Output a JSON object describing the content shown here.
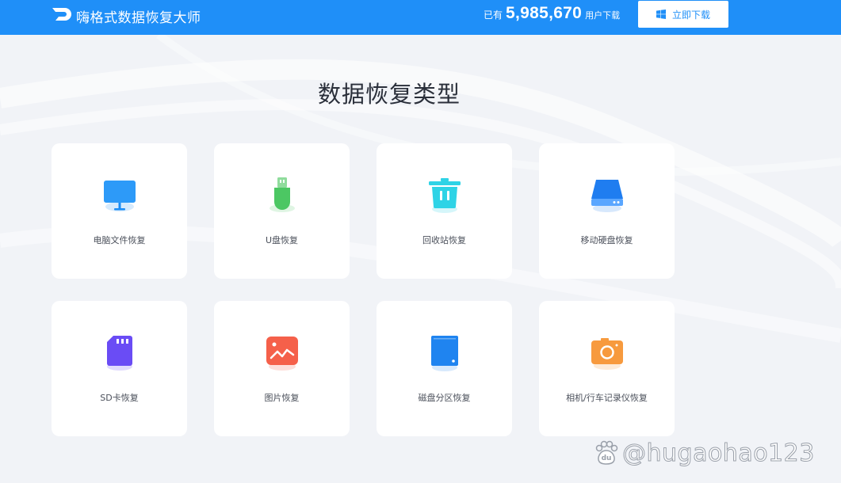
{
  "header": {
    "app_title": "嗨格式数据恢复大师",
    "stats_prefix": "已有",
    "stats_number": "5,985,670",
    "stats_suffix": "用户下载",
    "download_label": "立即下载",
    "brand_color": "#1f8ff8"
  },
  "main": {
    "section_title": "数据恢复类型",
    "cards": [
      {
        "label": "电脑文件恢复",
        "icon": "monitor-icon",
        "color": "#1a8cf5"
      },
      {
        "label": "U盘恢复",
        "icon": "usb-drive-icon",
        "color": "#4cc763"
      },
      {
        "label": "回收站恢复",
        "icon": "recycle-bin-icon",
        "color": "#2ed3e6"
      },
      {
        "label": "移动硬盘恢复",
        "icon": "hard-drive-icon",
        "color": "#1f7df0"
      },
      {
        "label": "SD卡恢复",
        "icon": "sd-card-icon",
        "color": "#6a4cf5"
      },
      {
        "label": "图片恢复",
        "icon": "picture-icon",
        "color": "#f5604a"
      },
      {
        "label": "磁盘分区恢复",
        "icon": "disk-partition-icon",
        "color": "#1f84f0"
      },
      {
        "label": "相机/行车记录仪恢复",
        "icon": "camera-icon",
        "color": "#f79a3e"
      }
    ]
  },
  "watermark": {
    "text": "@hugaohao123",
    "logo_text": "du"
  }
}
